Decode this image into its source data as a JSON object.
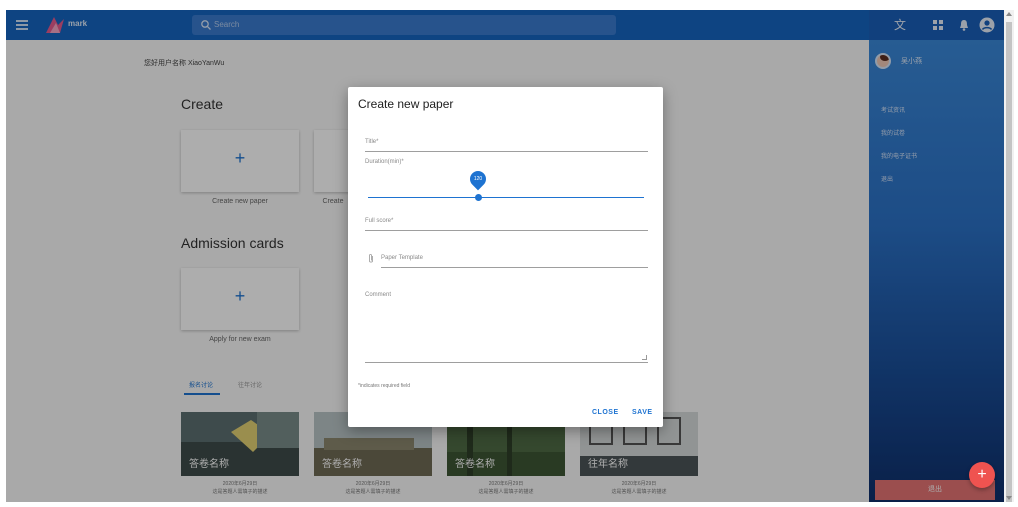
{
  "appbar": {
    "logo_text": "mark",
    "search_placeholder": "Search"
  },
  "main": {
    "welcome": "您好用户名称 XiaoYanWu",
    "create_section": {
      "title": "Create",
      "cards": [
        {
          "label": "Create new paper"
        },
        {
          "label": "Create"
        }
      ]
    },
    "admission_section": {
      "title": "Admission cards",
      "cards": [
        {
          "label": "Apply for new exam"
        }
      ]
    },
    "tabs": [
      {
        "label": "报名讨论",
        "active": true
      },
      {
        "label": "往年讨论",
        "active": false
      }
    ],
    "exams": [
      {
        "title": "答卷名称",
        "date": "2020年6月29日",
        "desc": "这是答题人需填子的描述"
      },
      {
        "title": "答卷名称",
        "date": "2020年6月29日",
        "desc": "这是答题人需填子的描述"
      },
      {
        "title": "答卷名称",
        "date": "2020年6月29日",
        "desc": "这是答题人需填子的描述"
      },
      {
        "title": "往年名称",
        "date": "2020年6月29日",
        "desc": "这是答题人需填子的描述"
      }
    ]
  },
  "drawer": {
    "username": "吴小燕",
    "items": [
      "考试资讯",
      "我的试卷",
      "我的电子证书",
      "退出"
    ],
    "bottom_button": "退出",
    "fab_label": "+"
  },
  "dialog": {
    "title": "Create new paper",
    "fields": {
      "title_label": "Title*",
      "duration_label": "Duration(min)*",
      "duration_value": "120",
      "full_score_label": "Full score*",
      "template_label": "Paper Template",
      "comment_label": "Comment"
    },
    "required_note": "*indicates required field",
    "close_label": "CLOSE",
    "save_label": "SAVE",
    "slider_fraction": 0.4
  },
  "colors": {
    "primary": "#1565c0",
    "accent": "#1e73d1",
    "fab": "#ef5350"
  },
  "icons": [
    "menu-icon",
    "search-icon",
    "translate-icon",
    "grid-icon",
    "bell-icon",
    "account-icon",
    "paperclip-icon",
    "plus-icon"
  ]
}
